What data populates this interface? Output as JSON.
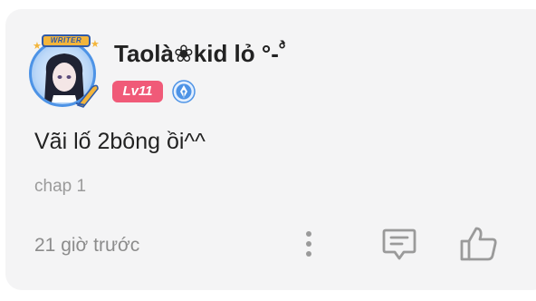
{
  "comment": {
    "author": {
      "name": "Taolà❀kid lỏ °-˚̀",
      "badge_label": "WRITER",
      "level": "Lv11"
    },
    "text": "Vãi lố 2bông ồi^^",
    "chapter": "chap 1",
    "timestamp": "21 giờ trước"
  },
  "icons": {
    "more": "more-vertical-icon",
    "reply": "reply-message-icon",
    "like": "thumbs-up-icon",
    "verified": "pen-nib-icon"
  },
  "colors": {
    "card_bg": "#f4f4f5",
    "level_badge": "#f05a78",
    "verified_badge": "#4d93e6",
    "text_primary": "#222222",
    "text_secondary": "#8c8c8c",
    "icon_gray": "#9a9a9a"
  }
}
